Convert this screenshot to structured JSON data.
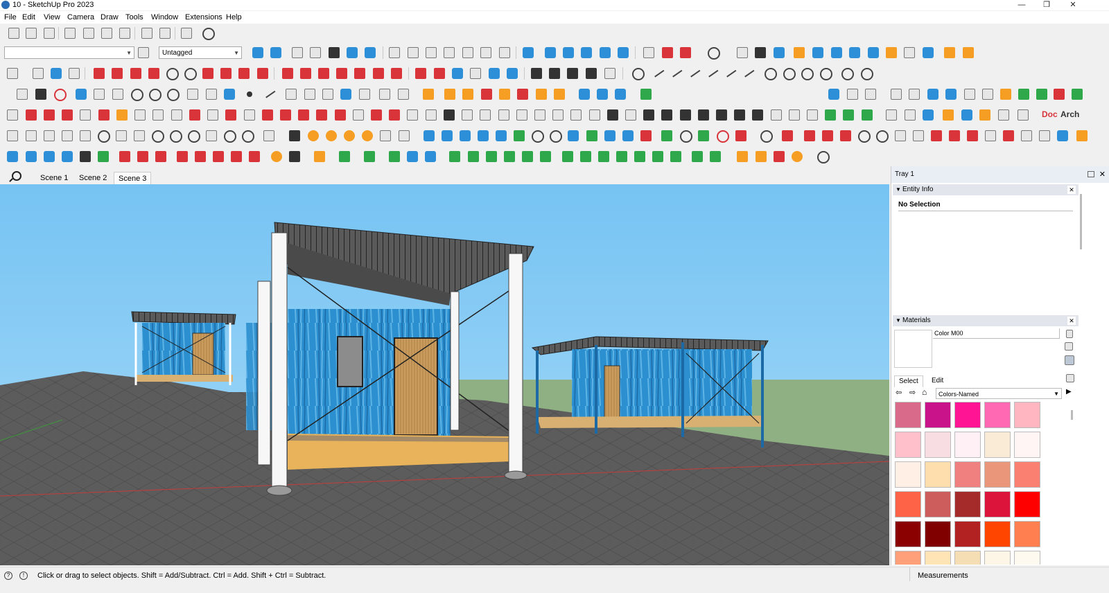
{
  "window": {
    "title": "10 - SketchUp Pro 2023",
    "minimize": "—",
    "maximize": "❐",
    "close": "✕"
  },
  "menu": [
    "File",
    "Edit",
    "View",
    "Camera",
    "Draw",
    "Tools",
    "Window",
    "Extensions",
    "Help"
  ],
  "toolbar": {
    "layer_combo": "",
    "tag_combo": "Untagged",
    "doc_label": "Doc",
    "arch_label": "Arch"
  },
  "scenes": {
    "tabs": [
      "Scene 1",
      "Scene 2",
      "Scene 3"
    ],
    "active": "Scene 3"
  },
  "tray": {
    "title": "Tray 1",
    "entity_info": {
      "title": "Entity Info",
      "selection": "No Selection"
    },
    "materials": {
      "title": "Materials",
      "material_name": "Color M00",
      "tabs": [
        "Select",
        "Edit"
      ],
      "library": "Colors-Named",
      "swatches": [
        "#d96a8a",
        "#c9138b",
        "#ff1493",
        "#ff69b4",
        "#ffb6c1",
        "#ffc0cb",
        "#f8dde3",
        "#fff0f5",
        "#faebd7",
        "#fff5f5",
        "#ffefe4",
        "#ffdead",
        "#f08080",
        "#e9967a",
        "#fa8072",
        "#ff6347",
        "#cd5c5c",
        "#a52a2a",
        "#dc143c",
        "#ff0000",
        "#8b0000",
        "#800000",
        "#b22222",
        "#ff4500",
        "#ff7f50",
        "#ffa07a",
        "#ffe4b5",
        "#f5deb3",
        "#fdf5e6",
        "#fffaf0"
      ]
    }
  },
  "status": {
    "message": "Click or drag to select objects. Shift = Add/Subtract. Ctrl = Add. Shift + Ctrl = Subtract.",
    "measurements_label": "Measurements"
  },
  "colors": {
    "sky": "#7fc8f4",
    "ground": "#5a5a5a",
    "grass": "#8fb083",
    "wall": "#2c8fcf",
    "roof": "#3a3a3a"
  }
}
